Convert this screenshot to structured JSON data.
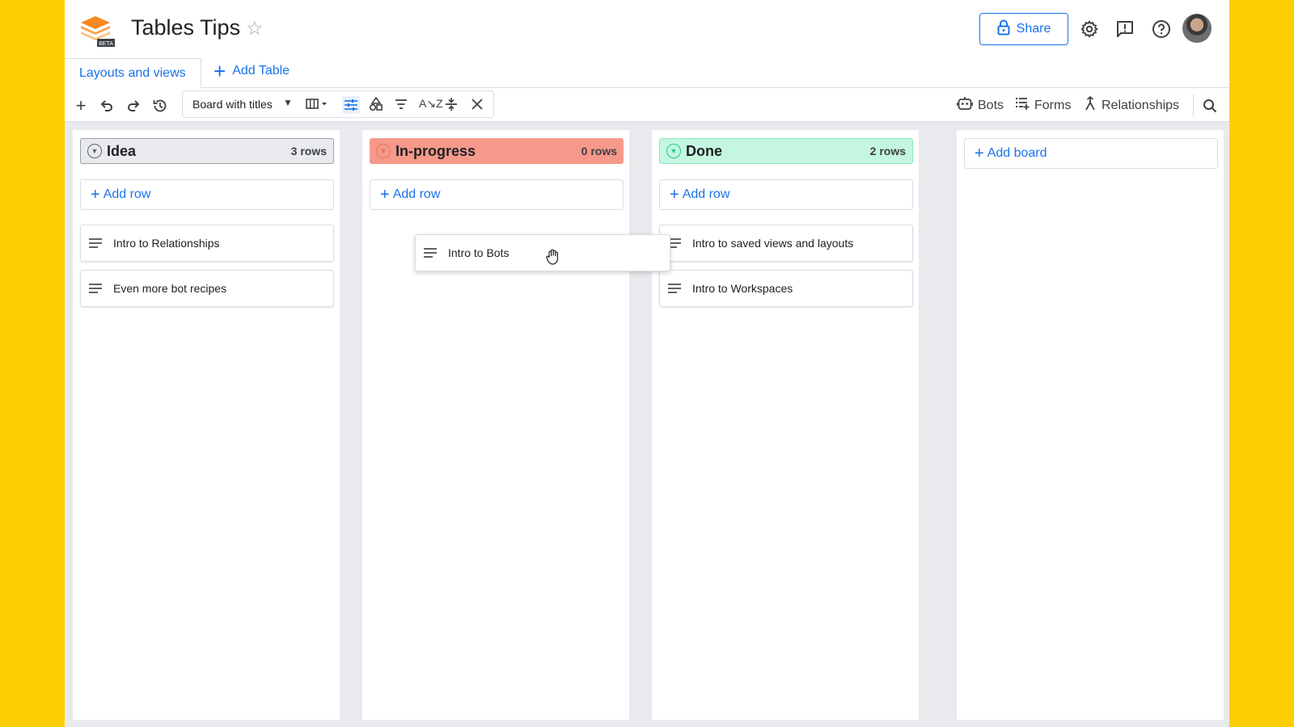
{
  "header": {
    "title": "Tables Tips",
    "logo_badge": "BETA",
    "share_label": "Share",
    "icons": [
      "star-icon",
      "lock-icon",
      "gear-icon",
      "feedback-icon",
      "help-icon",
      "avatar"
    ]
  },
  "tabs": {
    "active_label": "Layouts and views",
    "add_table_label": "Add Table"
  },
  "toolbar": {
    "view_select": "Board with titles",
    "bots_label": "Bots",
    "forms_label": "Forms",
    "relationships_label": "Relationships"
  },
  "colors": {
    "accent": "#1a73e8",
    "idea": "#e8eaed",
    "in_progress": "#f6998a",
    "done": "#c4f6e0",
    "background": "#FFCE00"
  },
  "board": {
    "add_row_label": "Add row",
    "add_board_label": "Add board",
    "columns": [
      {
        "name": "Idea",
        "count": "3 rows",
        "cards": [
          "Intro to Relationships",
          "Even more bot recipes"
        ]
      },
      {
        "name": "In-progress",
        "count": "0 rows",
        "cards": []
      },
      {
        "name": "Done",
        "count": "2 rows",
        "cards": [
          "Intro to saved views and layouts",
          "Intro to Workspaces"
        ]
      }
    ],
    "dragging_card": "Intro to Bots"
  }
}
